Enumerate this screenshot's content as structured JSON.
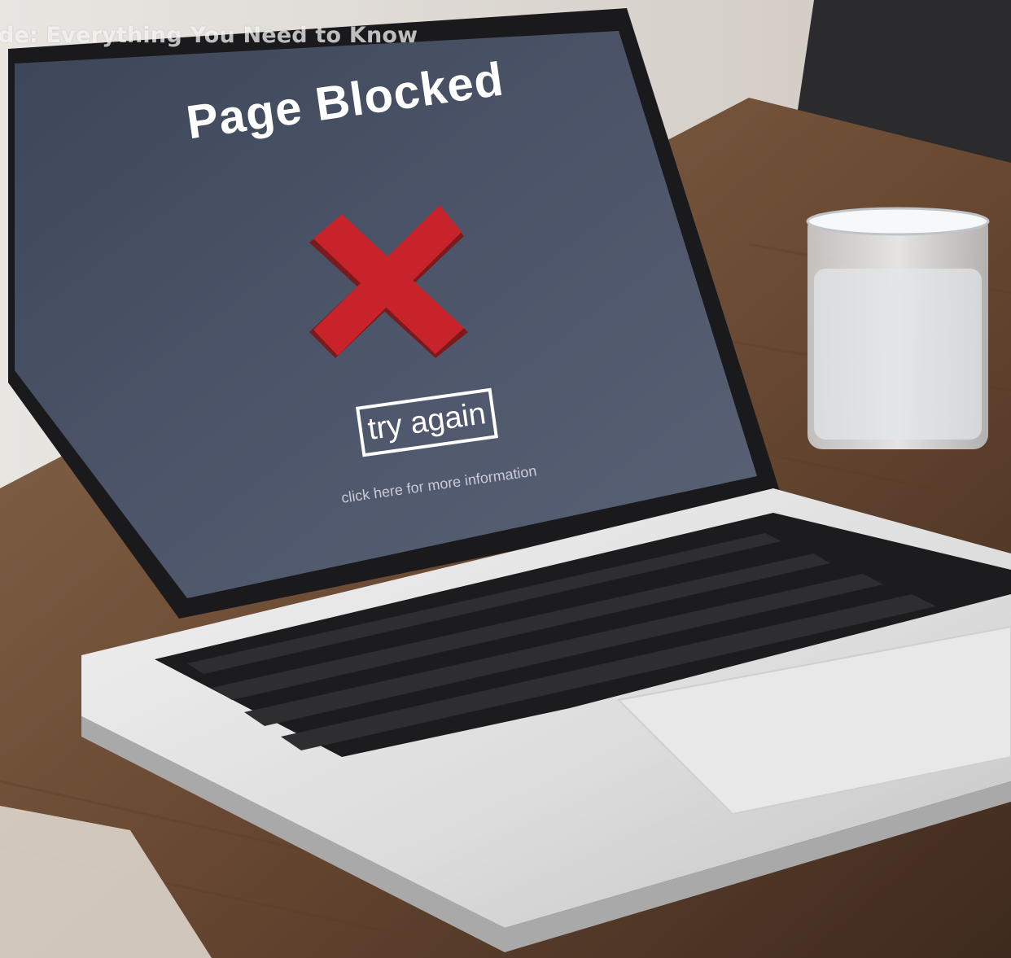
{
  "overlay": {
    "caption": "de: Everything You Need to Know"
  },
  "screen": {
    "title": "Page Blocked",
    "button_label": "try again",
    "link_text": "click here for more information",
    "colors": {
      "screen_bg": "#4a5266",
      "cross": "#c8232a",
      "text": "#ffffff"
    }
  },
  "icons": {
    "blocked": "x-mark-icon"
  }
}
